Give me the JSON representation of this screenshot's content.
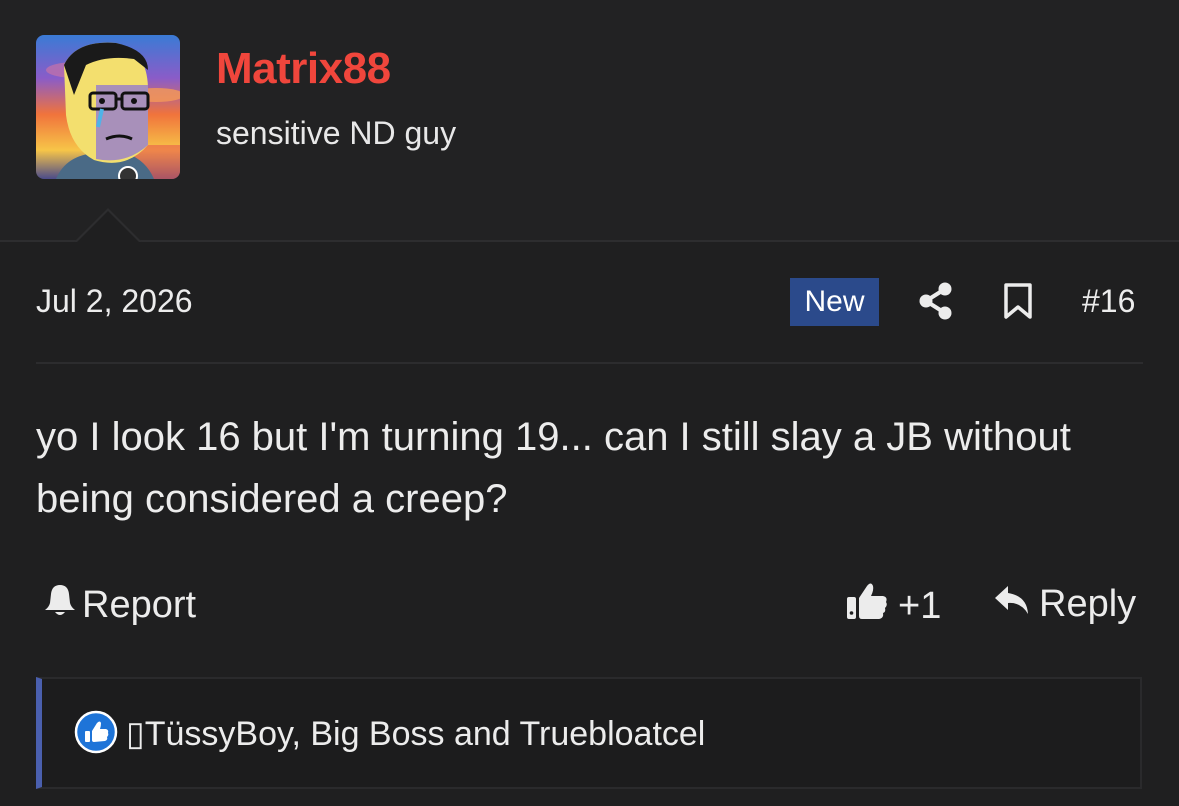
{
  "user": {
    "name": "Matrix88",
    "title": "sensitive ND guy",
    "name_color": "#f0463c",
    "avatar_icon": "wojak-avatar"
  },
  "post": {
    "date": "Jul 2, 2026",
    "badge": "New",
    "number": "#16",
    "message": "yo I look 16 but I'm turning 19... can I still slay a JB without being considered a creep?"
  },
  "actions": {
    "report": "Report",
    "like_count": "+1",
    "reply": "Reply"
  },
  "reactions": {
    "users": "▯TüssyBoy, Big Boss and Truebloatcel",
    "icon": "thumbs-up-icon"
  },
  "colors": {
    "background": "#222223",
    "badge": "#2b4a8b",
    "accent_bar": "#4a5fae",
    "reaction_blue": "#1e74d8"
  }
}
